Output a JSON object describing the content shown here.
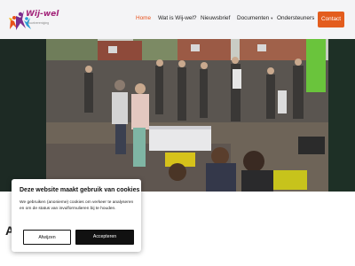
{
  "header": {
    "logo_text": "Wij-wel",
    "logo_sub": "buurtvereniging",
    "nav": [
      {
        "label": "Home",
        "active": true
      },
      {
        "label": "Wat is Wij-wel?",
        "active": false
      },
      {
        "label": "Nieuwsbrief",
        "active": false
      },
      {
        "label": "Documenten",
        "active": false,
        "dropdown": true
      },
      {
        "label": "Ondersteuners",
        "active": false
      }
    ],
    "contact_label": "Contact"
  },
  "colors": {
    "accent": "#e35d1e",
    "active_link": "#e8501a",
    "logo_purple": "#a3247a"
  },
  "hero": {
    "alt": "Buurtfeest op straat met veel bezoekers"
  },
  "page": {
    "section_letter": "A"
  },
  "cookie": {
    "title": "Deze website maakt gebruik van cookies",
    "text": "We gebruiken (anonieme) cookies om verkeer te analyseren en om de status van invulformulieren bij te houden.",
    "decline_label": "Afwijzen",
    "accept_label": "Accepteren"
  }
}
